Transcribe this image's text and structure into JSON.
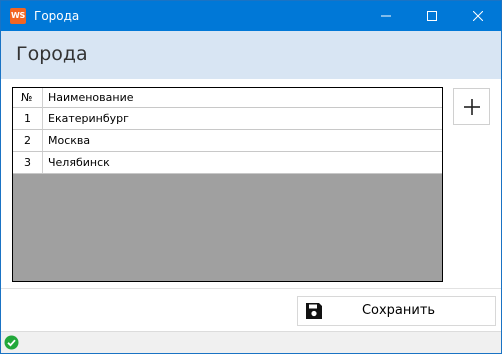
{
  "window": {
    "title": "Города",
    "logo_text": "WS",
    "controls": {
      "minimize_icon": "minimize-icon",
      "maximize_icon": "maximize-icon",
      "close_icon": "close-icon"
    }
  },
  "header": {
    "title": "Города"
  },
  "grid": {
    "columns": [
      {
        "label": "№"
      },
      {
        "label": "Наименование"
      }
    ],
    "rows": [
      {
        "num": "1",
        "name": "Екатеринбург"
      },
      {
        "num": "2",
        "name": "Москва"
      },
      {
        "num": "3",
        "name": "Челябинск"
      }
    ]
  },
  "toolbar": {
    "add_icon": "plus-icon"
  },
  "footer": {
    "save_label": "Сохранить",
    "save_icon": "floppy-disk-icon"
  },
  "status": {
    "icon": "check-circle-icon"
  },
  "colors": {
    "titlebar": "#0078d7",
    "header_band": "#d8e5f3",
    "grid_empty": "#a0a0a0",
    "logo": "#f26522",
    "status_ok": "#22a83a"
  }
}
